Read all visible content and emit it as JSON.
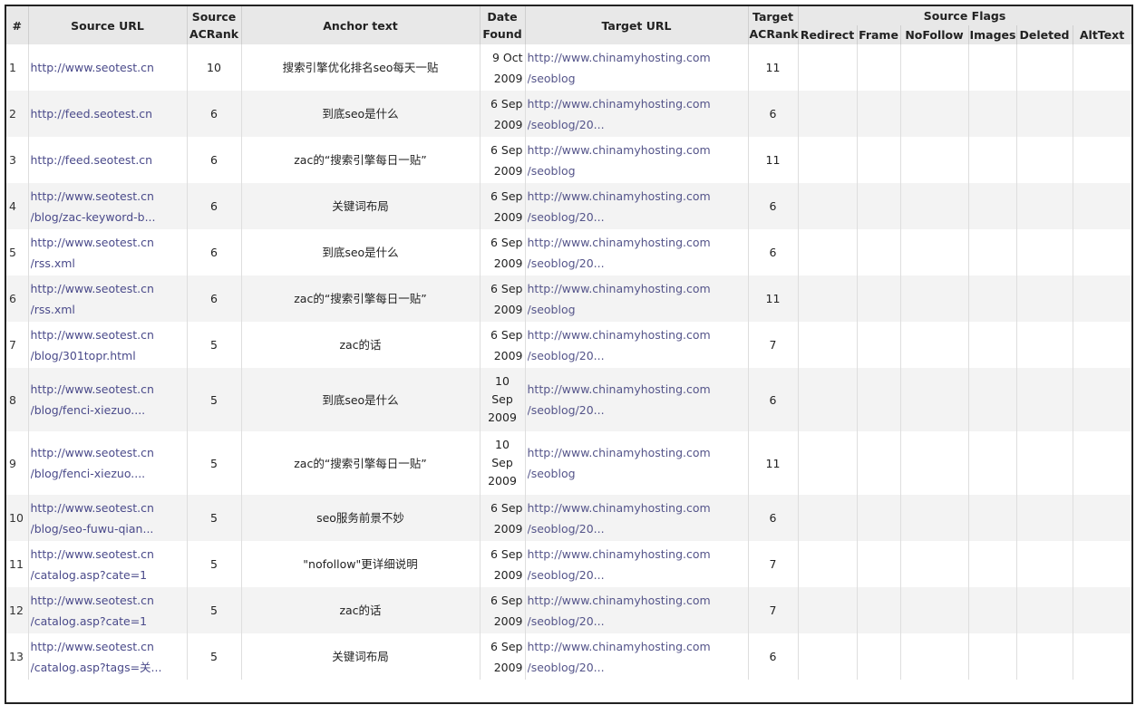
{
  "headers": {
    "index": "#",
    "source_url": "Source URL",
    "source_acrank": [
      "Source",
      "ACRank"
    ],
    "anchor_text": "Anchor text",
    "date_found": [
      "Date",
      "Found"
    ],
    "target_url": "Target URL",
    "target_acrank": [
      "Target",
      "ACRank"
    ],
    "source_flags": "Source Flags",
    "flags": [
      "Redirect",
      "Frame",
      "NoFollow",
      "Images",
      "Deleted",
      "AltText"
    ]
  },
  "rows": [
    {
      "n": "1",
      "source": [
        "http://www.seotest.cn"
      ],
      "s_rank": "10",
      "anchor": "搜索引擎优化排名seo每天一贴",
      "date": [
        "9 Oct",
        "2009"
      ],
      "target": [
        "http://www.chinamyhosting.com",
        "/seoblog"
      ],
      "t_rank": "11"
    },
    {
      "n": "2",
      "source": [
        "http://feed.seotest.cn"
      ],
      "s_rank": "6",
      "anchor": "到底seo是什么",
      "date": [
        "6 Sep",
        "2009"
      ],
      "target": [
        "http://www.chinamyhosting.com",
        "/seoblog/20..."
      ],
      "t_rank": "6"
    },
    {
      "n": "3",
      "source": [
        "http://feed.seotest.cn"
      ],
      "s_rank": "6",
      "anchor": "zac的“搜索引擎每日一贴”",
      "date": [
        "6 Sep",
        "2009"
      ],
      "target": [
        "http://www.chinamyhosting.com",
        "/seoblog"
      ],
      "t_rank": "11"
    },
    {
      "n": "4",
      "source": [
        "http://www.seotest.cn",
        "/blog/zac-keyword-b..."
      ],
      "s_rank": "6",
      "anchor": "关键词布局",
      "date": [
        "6 Sep",
        "2009"
      ],
      "target": [
        "http://www.chinamyhosting.com",
        "/seoblog/20..."
      ],
      "t_rank": "6"
    },
    {
      "n": "5",
      "source": [
        "http://www.seotest.cn",
        "/rss.xml"
      ],
      "s_rank": "6",
      "anchor": "到底seo是什么",
      "date": [
        "6 Sep",
        "2009"
      ],
      "target": [
        "http://www.chinamyhosting.com",
        "/seoblog/20..."
      ],
      "t_rank": "6"
    },
    {
      "n": "6",
      "source": [
        "http://www.seotest.cn",
        "/rss.xml"
      ],
      "s_rank": "6",
      "anchor": "zac的“搜索引擎每日一贴”",
      "date": [
        "6 Sep",
        "2009"
      ],
      "target": [
        "http://www.chinamyhosting.com",
        "/seoblog"
      ],
      "t_rank": "11"
    },
    {
      "n": "7",
      "source": [
        "http://www.seotest.cn",
        "/blog/301topr.html"
      ],
      "s_rank": "5",
      "anchor": "zac的话",
      "date": [
        "6 Sep",
        "2009"
      ],
      "target": [
        "http://www.chinamyhosting.com",
        "/seoblog/20..."
      ],
      "t_rank": "7"
    },
    {
      "n": "8",
      "source": [
        "http://www.seotest.cn",
        "/blog/fenci-xiezuo...."
      ],
      "s_rank": "5",
      "anchor": "到底seo是什么",
      "date": [
        "10",
        "Sep",
        "2009"
      ],
      "target": [
        "http://www.chinamyhosting.com",
        "/seoblog/20..."
      ],
      "t_rank": "6"
    },
    {
      "n": "9",
      "source": [
        "http://www.seotest.cn",
        "/blog/fenci-xiezuo...."
      ],
      "s_rank": "5",
      "anchor": "zac的“搜索引擎每日一贴”",
      "date": [
        "10",
        "Sep",
        "2009"
      ],
      "target": [
        "http://www.chinamyhosting.com",
        "/seoblog"
      ],
      "t_rank": "11"
    },
    {
      "n": "10",
      "source": [
        "http://www.seotest.cn",
        "/blog/seo-fuwu-qian..."
      ],
      "s_rank": "5",
      "anchor": "seo服务前景不妙",
      "date": [
        "6 Sep",
        "2009"
      ],
      "target": [
        "http://www.chinamyhosting.com",
        "/seoblog/20..."
      ],
      "t_rank": "6"
    },
    {
      "n": "11",
      "source": [
        "http://www.seotest.cn",
        "/catalog.asp?cate=1"
      ],
      "s_rank": "5",
      "anchor": "\"nofollow\"更详细说明",
      "date": [
        "6 Sep",
        "2009"
      ],
      "target": [
        "http://www.chinamyhosting.com",
        "/seoblog/20..."
      ],
      "t_rank": "7"
    },
    {
      "n": "12",
      "source": [
        "http://www.seotest.cn",
        "/catalog.asp?cate=1"
      ],
      "s_rank": "5",
      "anchor": "zac的话",
      "date": [
        "6 Sep",
        "2009"
      ],
      "target": [
        "http://www.chinamyhosting.com",
        "/seoblog/20..."
      ],
      "t_rank": "7"
    },
    {
      "n": "13",
      "source": [
        "http://www.seotest.cn",
        "/catalog.asp?tags=关..."
      ],
      "s_rank": "5",
      "anchor": "关键词布局",
      "date": [
        "6 Sep",
        "2009"
      ],
      "target": [
        "http://www.chinamyhosting.com",
        "/seoblog/20..."
      ],
      "t_rank": "6"
    }
  ],
  "colors": {
    "header_bg": "#e8e8e8",
    "link": "#4a4a8a",
    "row_alt": "#f3f3f3",
    "frame_border": "#222222"
  }
}
